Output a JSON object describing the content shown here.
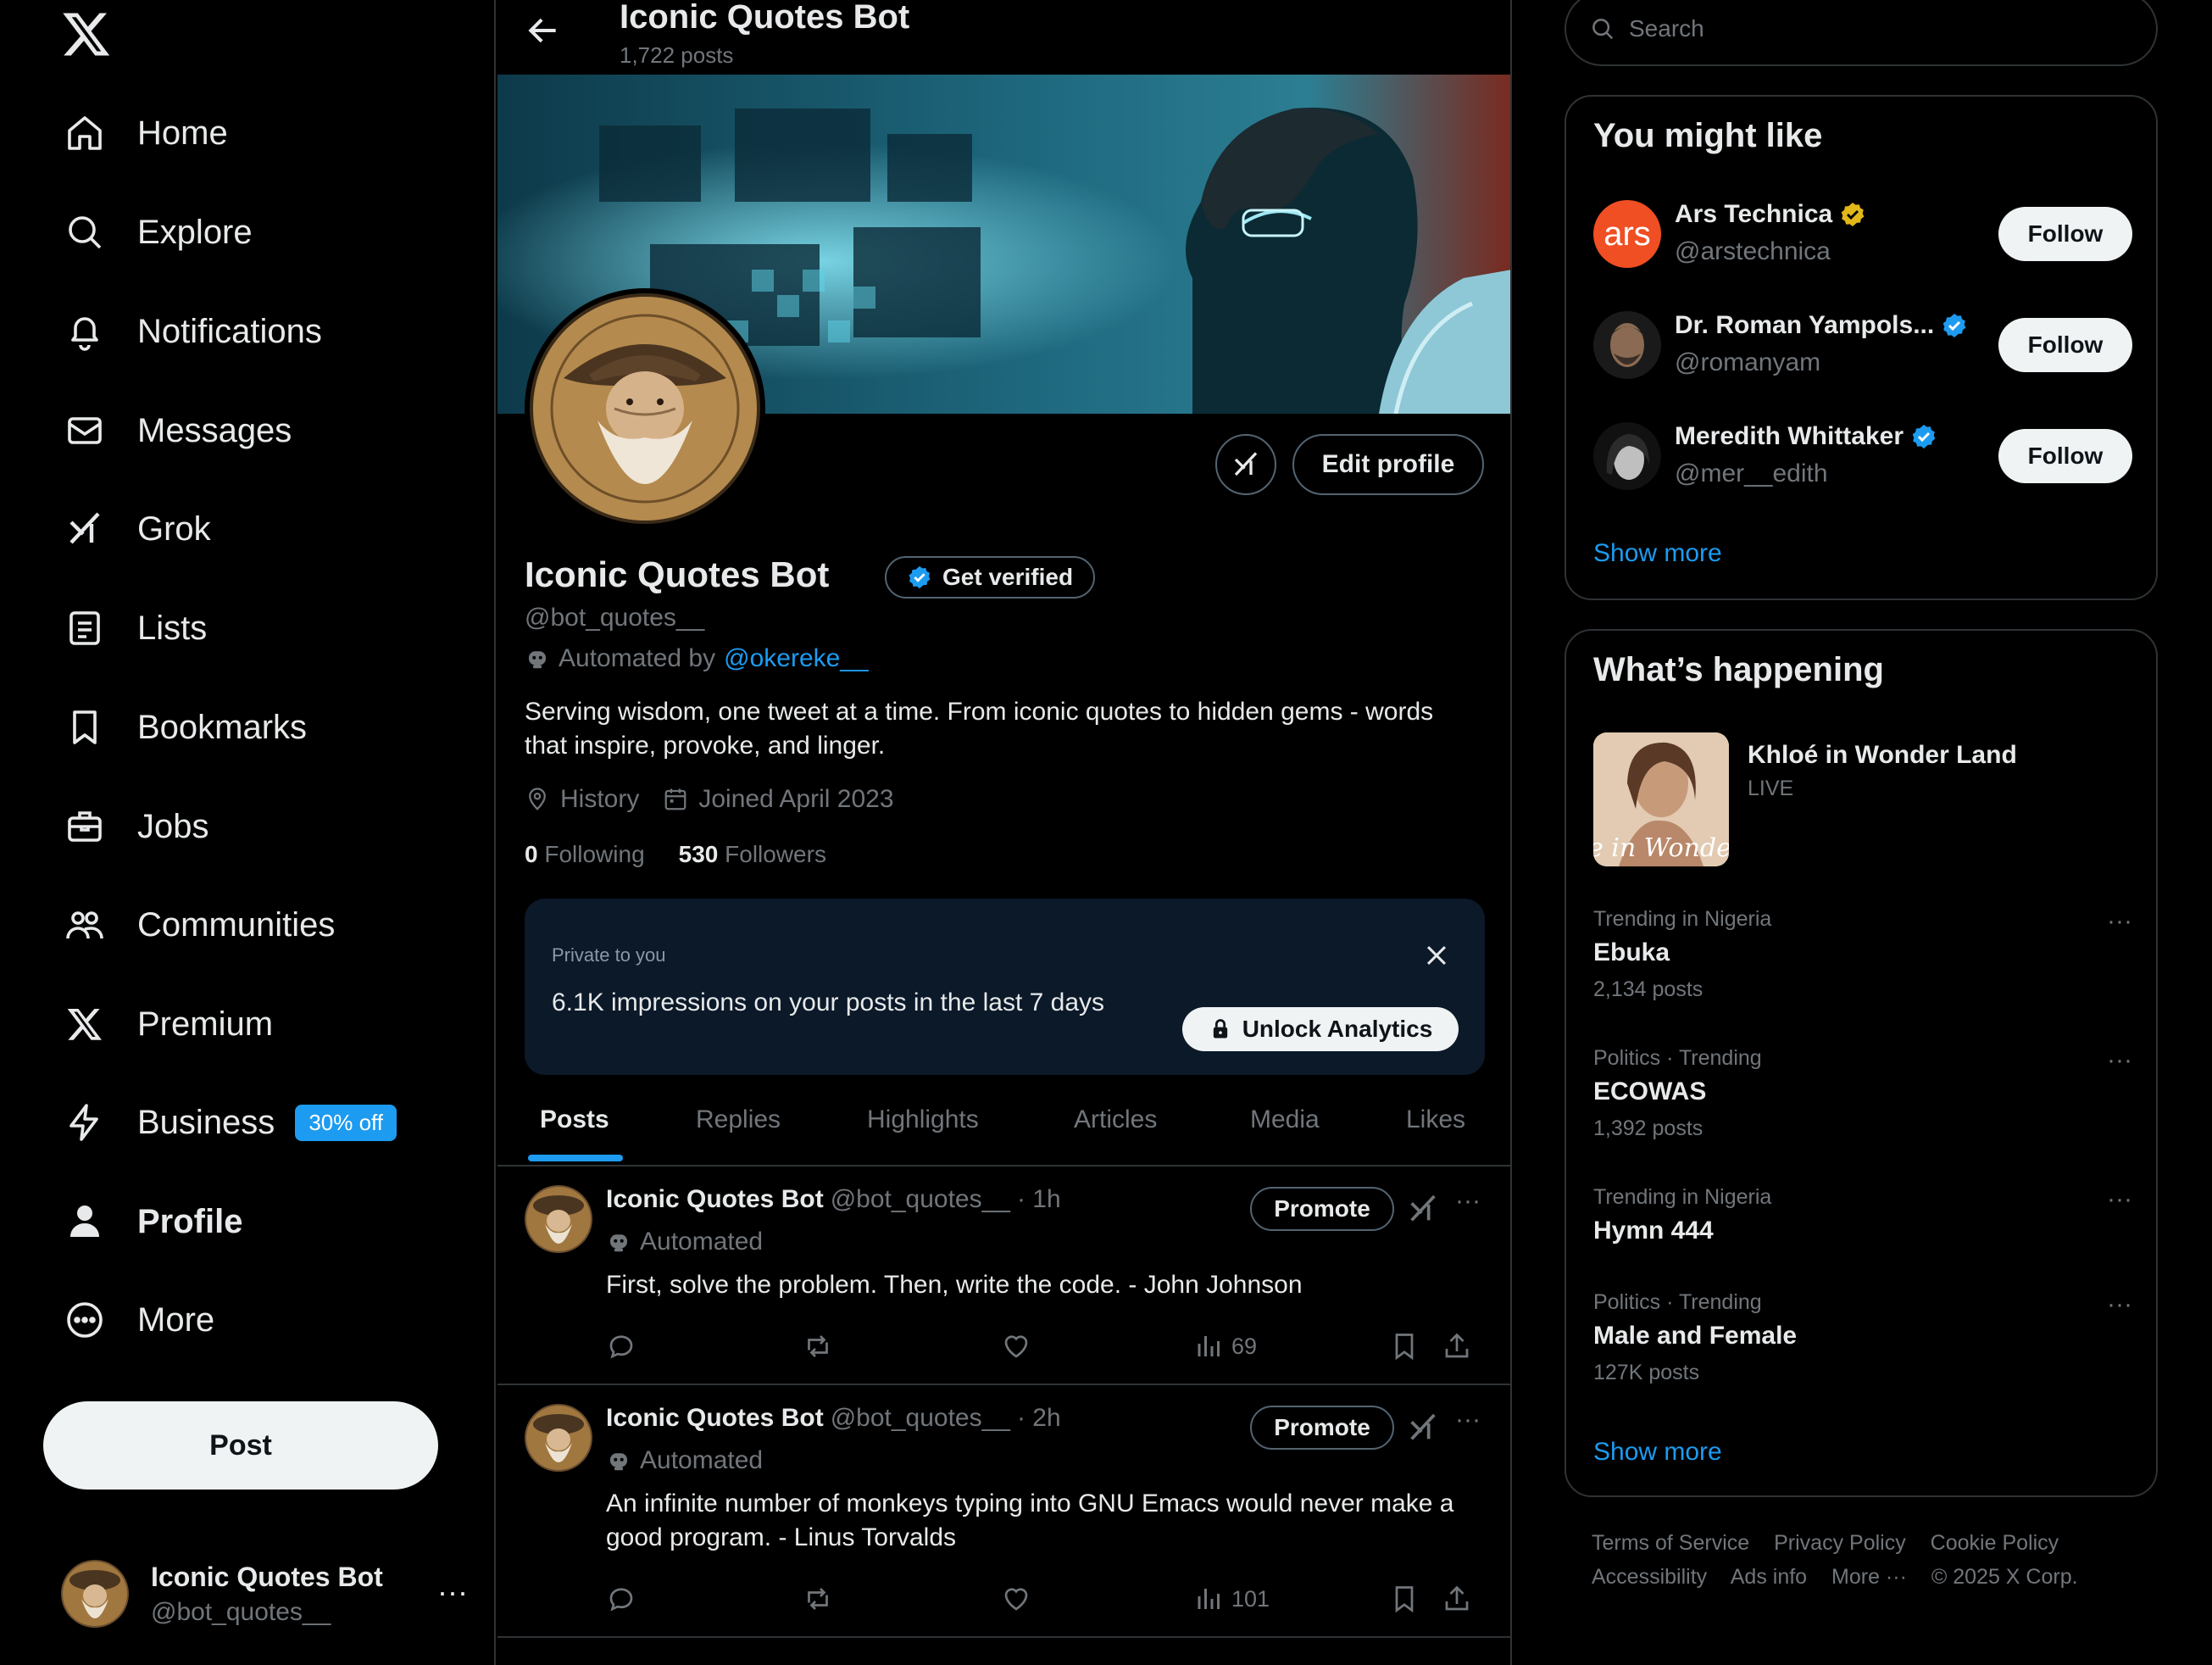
{
  "nav": {
    "items": [
      {
        "label": "Home",
        "icon": "home-icon"
      },
      {
        "label": "Explore",
        "icon": "search-icon"
      },
      {
        "label": "Notifications",
        "icon": "bell-icon"
      },
      {
        "label": "Messages",
        "icon": "mail-icon"
      },
      {
        "label": "Grok",
        "icon": "grok-icon"
      },
      {
        "label": "Lists",
        "icon": "list-icon"
      },
      {
        "label": "Bookmarks",
        "icon": "bookmark-icon"
      },
      {
        "label": "Jobs",
        "icon": "briefcase-icon"
      },
      {
        "label": "Communities",
        "icon": "people-icon"
      },
      {
        "label": "Premium",
        "icon": "x-icon"
      },
      {
        "label": "Business",
        "icon": "lightning-icon",
        "badge": "30% off"
      },
      {
        "label": "Profile",
        "icon": "person-icon"
      },
      {
        "label": "More",
        "icon": "more-circle-icon"
      }
    ],
    "post_label": "Post",
    "account": {
      "name": "Iconic Quotes Bot",
      "handle": "@bot_quotes__",
      "more": "···"
    }
  },
  "header": {
    "title": "Iconic Quotes Bot",
    "posts": "1,722 posts"
  },
  "profile": {
    "edit_label": "Edit profile",
    "name": "Iconic Quotes Bot",
    "verify_label": "Get verified",
    "handle": "@bot_quotes__",
    "automated_prefix": "Automated by",
    "automated_by": "@okereke__",
    "bio": "Serving wisdom, one tweet at a time. From iconic quotes to hidden gems - words that inspire, provoke, and linger.",
    "location": "History",
    "joined": "Joined April 2023",
    "following_count": "0",
    "following_label": "Following",
    "followers_count": "530",
    "followers_label": "Followers"
  },
  "analytics": {
    "private": "Private to you",
    "text": "6.1K impressions on your posts in the last 7 days",
    "unlock_label": "Unlock Analytics"
  },
  "tabs": [
    "Posts",
    "Replies",
    "Highlights",
    "Articles",
    "Media",
    "Likes"
  ],
  "tweets": [
    {
      "name": "Iconic Quotes Bot",
      "handle": "@bot_quotes__",
      "time": "· 1h",
      "automated": "Automated",
      "promote": "Promote",
      "more": "···",
      "text": "First, solve the problem. Then, write the code. - John Johnson",
      "views": "69"
    },
    {
      "name": "Iconic Quotes Bot",
      "handle": "@bot_quotes__",
      "time": "· 2h",
      "automated": "Automated",
      "promote": "Promote",
      "more": "···",
      "text": "An infinite number of monkeys typing into GNU Emacs would never make a good program. - Linus Torvalds",
      "views": "101"
    }
  ],
  "search": {
    "placeholder": "Search"
  },
  "suggestions": {
    "title": "You might like",
    "people": [
      {
        "name": "Ars Technica",
        "handle": "@arstechnica",
        "follow": "Follow",
        "verified_color": "#e2b719",
        "avatar_text": "ars"
      },
      {
        "name": "Dr. Roman Yampols...",
        "handle": "@romanyam",
        "follow": "Follow",
        "verified_color": "#1d9bf0"
      },
      {
        "name": "Meredith Whittaker",
        "handle": "@mer__edith",
        "follow": "Follow",
        "verified_color": "#1d9bf0"
      }
    ],
    "show_more": "Show more"
  },
  "happening": {
    "title": "What’s happening",
    "live": {
      "title": "Khloé in Wonder Land",
      "status": "LIVE",
      "thumb_text": "e in Wonder l"
    },
    "trends": [
      {
        "context": "Trending in Nigeria",
        "topic": "Ebuka",
        "posts": "2,134 posts"
      },
      {
        "context": "Politics · Trending",
        "topic": "ECOWAS",
        "posts": "1,392 posts"
      },
      {
        "context": "Trending in Nigeria",
        "topic": "Hymn 444",
        "posts": ""
      },
      {
        "context": "Politics · Trending",
        "topic": "Male and Female",
        "posts": "127K posts"
      }
    ],
    "more": "···",
    "show_more": "Show more"
  },
  "footer": {
    "links": [
      "Terms of Service",
      "Privacy Policy",
      "Cookie Policy",
      "Accessibility",
      "Ads info",
      "More ···"
    ],
    "copyright": "© 2025 X Corp."
  },
  "colors": {
    "accent": "#1d9bf0",
    "background": "#000000",
    "border": "#2f3336",
    "muted": "#71767b"
  }
}
